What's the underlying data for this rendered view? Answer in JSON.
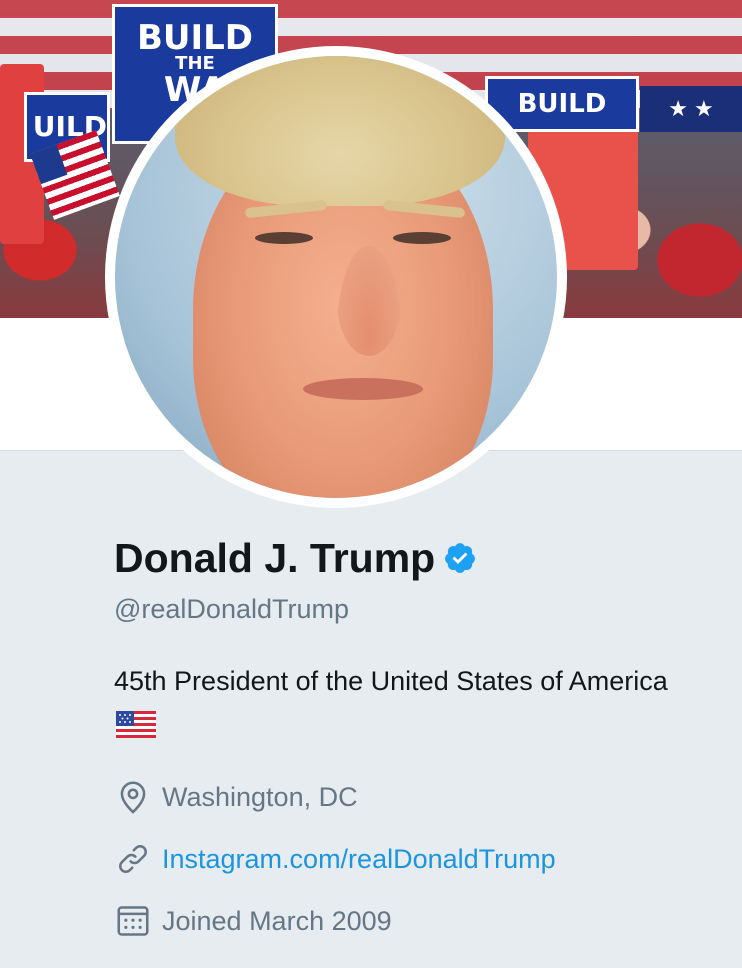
{
  "banner": {
    "sign_left_top": "BUILD",
    "sign_left_middle": "THE",
    "sign_left_bottom": "WA",
    "sign_right": "BUILD",
    "sign_far_left": "UILD",
    "stars": "★ ★"
  },
  "profile": {
    "name": "Donald J. Trump",
    "handle": "@realDonaldTrump",
    "bio": "45th President of the United States of America",
    "location": "Washington, DC",
    "website": "Instagram.com/realDonaldTrump",
    "joined": "Joined March 2009"
  },
  "icons": {
    "verified": "verified-badge-icon",
    "location": "location-pin-icon",
    "link": "link-icon",
    "calendar": "calendar-icon",
    "flag": "us-flag-emoji-icon"
  },
  "colors": {
    "name": "#14171a",
    "secondary": "#657786",
    "link": "#1b95e0",
    "verified": "#1da1f2",
    "background": "#e6ecf0"
  }
}
